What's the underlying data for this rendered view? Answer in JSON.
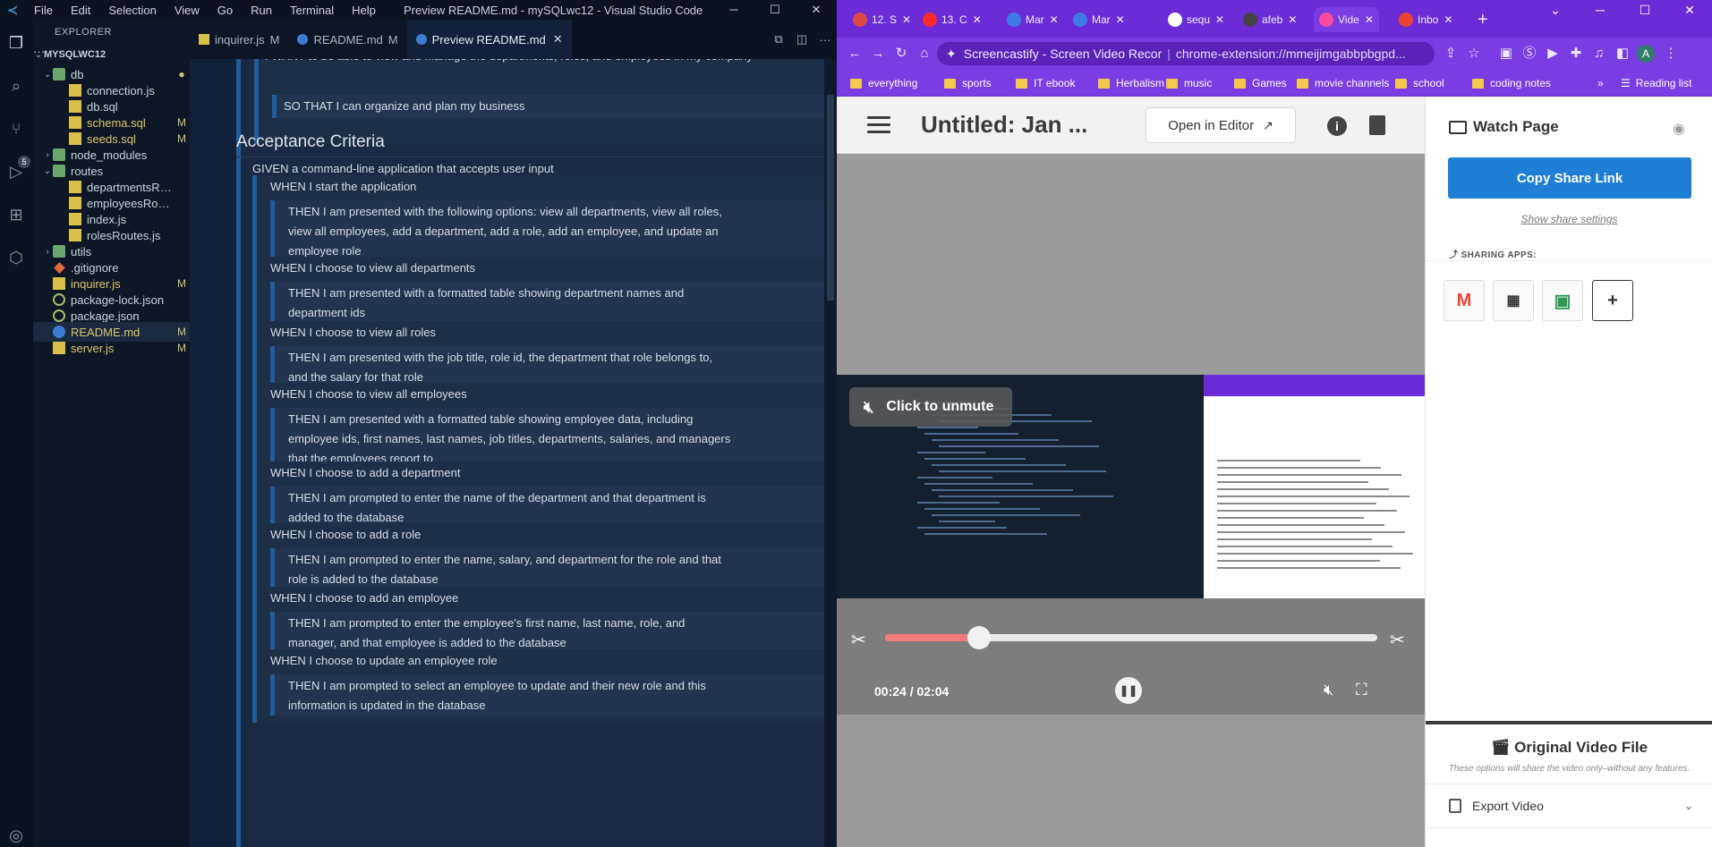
{
  "vscode": {
    "window_title": "Preview README.md - mySQLwc12 - Visual Studio Code",
    "menu": [
      "File",
      "Edit",
      "Selection",
      "View",
      "Go",
      "Run",
      "Terminal",
      "Help"
    ],
    "window_buttons": [
      "─",
      "☐",
      "✕"
    ],
    "activity_badge": "5",
    "explorer": {
      "header": "EXPLORER",
      "more": "···",
      "root": "MYSQLWC12",
      "tree": [
        {
          "label": "db",
          "type": "folder",
          "open": true,
          "badge": "●",
          "depth": 1
        },
        {
          "label": "connection.js",
          "type": "js",
          "badge": "",
          "depth": 2
        },
        {
          "label": "db.sql",
          "type": "sql",
          "badge": "",
          "depth": 2
        },
        {
          "label": "schema.sql",
          "type": "sql",
          "badge": "M",
          "depth": 2
        },
        {
          "label": "seeds.sql",
          "type": "sql",
          "badge": "M",
          "depth": 2
        },
        {
          "label": "node_modules",
          "type": "folder",
          "open": false,
          "badge": "",
          "depth": 1
        },
        {
          "label": "routes",
          "type": "folder",
          "open": true,
          "badge": "",
          "depth": 1
        },
        {
          "label": "departmentsRou...",
          "type": "js",
          "badge": "",
          "depth": 2
        },
        {
          "label": "employeesRoute...",
          "type": "js",
          "badge": "",
          "depth": 2
        },
        {
          "label": "index.js",
          "type": "js",
          "badge": "",
          "depth": 2
        },
        {
          "label": "rolesRoutes.js",
          "type": "js",
          "badge": "",
          "depth": 2
        },
        {
          "label": "utils",
          "type": "folder",
          "open": false,
          "badge": "",
          "depth": 1
        },
        {
          "label": ".gitignore",
          "type": "git",
          "badge": "",
          "depth": 1
        },
        {
          "label": "inquirer.js",
          "type": "js",
          "badge": "M",
          "depth": 1
        },
        {
          "label": "package-lock.json",
          "type": "json",
          "badge": "",
          "depth": 1
        },
        {
          "label": "package.json",
          "type": "json",
          "badge": "",
          "depth": 1
        },
        {
          "label": "README.md",
          "type": "info",
          "badge": "M",
          "depth": 1
        },
        {
          "label": "server.js",
          "type": "js",
          "badge": "M",
          "depth": 1
        }
      ]
    },
    "tabs": [
      {
        "label": "inquirer.js",
        "mod": "M",
        "active": false
      },
      {
        "label": "README.md",
        "mod": "M",
        "active": false
      },
      {
        "label": "Preview README.md",
        "mod": "✕",
        "active": true
      }
    ],
    "editor_actions": [
      "⧉",
      "◫",
      "···"
    ],
    "preview": {
      "want": "I WANT to be able to view and manage the departments, roles, and employees in my company",
      "sothat": "SO THAT I can organize and plan my business",
      "heading": "Acceptance Criteria",
      "given": "GIVEN a command-line application that accepts user input",
      "criteria": [
        {
          "when": "WHEN I start the application",
          "then": "THEN I am presented with the following options: view all departments, view all roles, view all employees, add a department, add a role, add an employee, and update an employee role"
        },
        {
          "when": "WHEN I choose to view all departments",
          "then": "THEN I am presented with a formatted table showing department names and department ids"
        },
        {
          "when": "WHEN I choose to view all roles",
          "then": "THEN I am presented with the job title, role id, the department that role belongs to, and the salary for that role"
        },
        {
          "when": "WHEN I choose to view all employees",
          "then": "THEN I am presented with a formatted table showing employee data, including employee ids, first names, last names, job titles, departments, salaries, and managers that the employees report to"
        },
        {
          "when": "WHEN I choose to add a department",
          "then": "THEN I am prompted to enter the name of the department and that department is added to the database"
        },
        {
          "when": "WHEN I choose to add a role",
          "then": "THEN I am prompted to enter the name, salary, and department for the role and that role is added to the database"
        },
        {
          "when": "WHEN I choose to add an employee",
          "then": "THEN I am prompted to enter the employee’s first name, last name, role, and manager, and that employee is added to the database"
        },
        {
          "when": "WHEN I choose to update an employee role",
          "then": "THEN I am prompted to select an employee to update and their new role and this information is updated in the database"
        }
      ]
    }
  },
  "chrome": {
    "tabs": [
      {
        "label": "12. S",
        "color": "#e04848"
      },
      {
        "label": "13. C",
        "color": "#ff2a2a"
      },
      {
        "label": "Mar",
        "color": "#3c7be6"
      },
      {
        "label": "Mar",
        "color": "#3c7be6"
      },
      {
        "label": "sequ",
        "color": "#ffffff"
      },
      {
        "label": "afeb",
        "color": "#444444"
      },
      {
        "label": "Vide",
        "color": "#ff4aa0"
      },
      {
        "label": "Inbo",
        "color": "#ea4335"
      }
    ],
    "new_tab": "+",
    "window_buttons": [
      "⌄",
      "─",
      "☐",
      "✕"
    ],
    "omnibox": {
      "site": "Screencastify - Screen Video Recor",
      "url": "chrome-extension://mmeijimgabbpbgpd..."
    },
    "bookmarks": [
      "everything",
      "sports",
      "IT ebook",
      "Herbalism",
      "music",
      "Games",
      "movie channels",
      "school",
      "coding notes"
    ],
    "bookmarks_more": "»",
    "reading_list": "Reading list",
    "profile_initial": "A"
  },
  "screencastify": {
    "title": "Untitled: Jan ...",
    "open_in_editor": "Open in Editor",
    "unmute": "Click to unmute",
    "timecode": "00:24 / 02:04",
    "progress": 0.19,
    "watch_page": "Watch Page",
    "copy_share_link": "Copy Share Link",
    "show_share_settings": "Show share settings",
    "sharing_apps": "SHARING APPS:",
    "original_video_file": "Original Video File",
    "original_note": "These options will share the video only–without any features.",
    "export_video": "Export Video"
  }
}
